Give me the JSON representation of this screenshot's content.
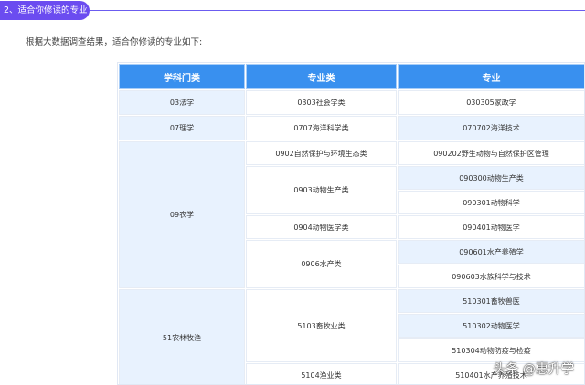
{
  "section": {
    "title": "2、适合你修读的专业"
  },
  "intro": "根据大数据调查结果，适合你修读的专业如下:",
  "table": {
    "headers": [
      "学科门类",
      "专业类",
      "专业"
    ],
    "rows": [
      {
        "category": "03法学",
        "class": "0303社会学类",
        "major": "030305家政学"
      },
      {
        "category": "07理学",
        "class": "0707海洋科学类",
        "major": "070702海洋技术"
      },
      {
        "category": "09农学",
        "class": "0902自然保护与环境生态类",
        "major": "090202野生动物与自然保护区管理"
      },
      {
        "category": "",
        "class": "0903动物生产类",
        "major": "090300动物生产类"
      },
      {
        "category": "",
        "class": "",
        "major": "090301动物科学"
      },
      {
        "category": "",
        "class": "0904动物医学类",
        "major": "090401动物医学"
      },
      {
        "category": "",
        "class": "0906水产类",
        "major": "090601水产养殖学"
      },
      {
        "category": "",
        "class": "",
        "major": "090603水族科学与技术"
      },
      {
        "category": "51农林牧渔",
        "class": "5103畜牧业类",
        "major": "510301畜牧兽医"
      },
      {
        "category": "",
        "class": "",
        "major": "510302动物医学"
      },
      {
        "category": "",
        "class": "",
        "major": "510304动物防疫与检疫"
      },
      {
        "category": "",
        "class": "5104渔业类",
        "major": "510401水产养殖技术"
      }
    ]
  },
  "watermark": "头条 @惠升学",
  "colors": {
    "accent": "#6b4cf0",
    "header_bg": "#3990ef",
    "cell_light": "#e8f2fe"
  }
}
